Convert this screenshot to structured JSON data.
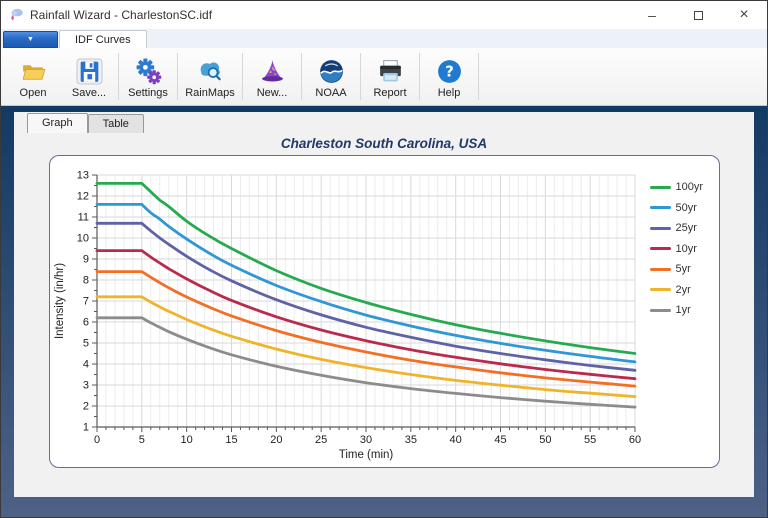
{
  "window": {
    "title": "Rainfall Wizard - CharlestonSC.idf",
    "controls": {
      "minimize_glyph": "–",
      "close_glyph": "×"
    }
  },
  "app_menu": {
    "dropdown_glyph": "▼"
  },
  "ribbon": {
    "tab_label": "IDF Curves"
  },
  "toolbar": {
    "buttons": [
      {
        "label": "Open",
        "icon": "folder-open-icon"
      },
      {
        "label": "Save...",
        "icon": "save-icon"
      },
      {
        "label": "Settings",
        "icon": "gears-icon"
      },
      {
        "label": "RainMaps",
        "icon": "cloud-search-icon"
      },
      {
        "label": "New...",
        "icon": "wizard-hat-icon"
      },
      {
        "label": "NOAA",
        "icon": "noaa-logo-icon"
      },
      {
        "label": "Report",
        "icon": "printer-icon"
      },
      {
        "label": "Help",
        "icon": "help-icon"
      }
    ]
  },
  "page_tabs": [
    {
      "label": "Graph",
      "active": true
    },
    {
      "label": "Table",
      "active": false
    }
  ],
  "chart_data": {
    "type": "line",
    "title": "Charleston South Carolina, USA",
    "xlabel": "Time (min)",
    "ylabel": "Intensity (in/hr)",
    "xlim": [
      0,
      60
    ],
    "ylim": [
      1,
      13
    ],
    "grid": true,
    "legend_position": "right",
    "x_tick_labels": [
      0,
      5,
      10,
      15,
      20,
      25,
      30,
      35,
      40,
      45,
      50,
      55,
      60
    ],
    "y_tick_labels": [
      1,
      2,
      3,
      4,
      5,
      6,
      7,
      8,
      9,
      10,
      11,
      12,
      13
    ],
    "x_minor_step": 1,
    "y_minor_step": 0.5,
    "x": [
      0,
      5,
      6,
      7,
      8,
      10,
      12.5,
      15,
      20,
      25,
      30,
      35,
      40,
      45,
      50,
      55,
      60
    ],
    "series": [
      {
        "name": "100yr",
        "color": "#25ab4f",
        "values": [
          12.6,
          12.6,
          12.2,
          11.8,
          11.5,
          10.8,
          10.1,
          9.5,
          8.45,
          7.6,
          6.93,
          6.36,
          5.87,
          5.46,
          5.1,
          4.78,
          4.5
        ]
      },
      {
        "name": "50yr",
        "color": "#2e97d5",
        "values": [
          11.6,
          11.6,
          11.2,
          10.9,
          10.55,
          9.95,
          9.28,
          8.7,
          7.74,
          6.97,
          6.33,
          5.81,
          5.36,
          4.98,
          4.65,
          4.36,
          4.1
        ]
      },
      {
        "name": "25yr",
        "color": "#5f63a5",
        "values": [
          10.7,
          10.7,
          10.34,
          10.0,
          9.7,
          9.13,
          8.5,
          7.96,
          7.06,
          6.34,
          5.75,
          5.27,
          4.85,
          4.5,
          4.2,
          3.93,
          3.7
        ]
      },
      {
        "name": "10yr",
        "color": "#b92a4c",
        "values": [
          9.4,
          9.4,
          9.09,
          8.81,
          8.54,
          8.05,
          7.51,
          7.03,
          6.25,
          5.62,
          5.11,
          4.68,
          4.32,
          4.01,
          3.74,
          3.51,
          3.3
        ]
      },
      {
        "name": "5yr",
        "color": "#f36f24",
        "values": [
          8.4,
          8.4,
          8.13,
          7.87,
          7.63,
          7.19,
          6.71,
          6.29,
          5.59,
          5.03,
          4.57,
          4.18,
          3.86,
          3.58,
          3.34,
          3.14,
          2.95
        ]
      },
      {
        "name": "2yr",
        "color": "#f0b42a",
        "values": [
          7.2,
          7.2,
          6.95,
          6.72,
          6.51,
          6.12,
          5.69,
          5.32,
          4.71,
          4.22,
          3.83,
          3.5,
          3.22,
          2.99,
          2.78,
          2.61,
          2.45
        ]
      },
      {
        "name": "1yr",
        "color": "#8c8c8c",
        "values": [
          6.2,
          6.2,
          5.96,
          5.75,
          5.54,
          5.18,
          4.78,
          4.44,
          3.89,
          3.46,
          3.11,
          2.83,
          2.6,
          2.4,
          2.23,
          2.08,
          1.95
        ]
      }
    ]
  }
}
